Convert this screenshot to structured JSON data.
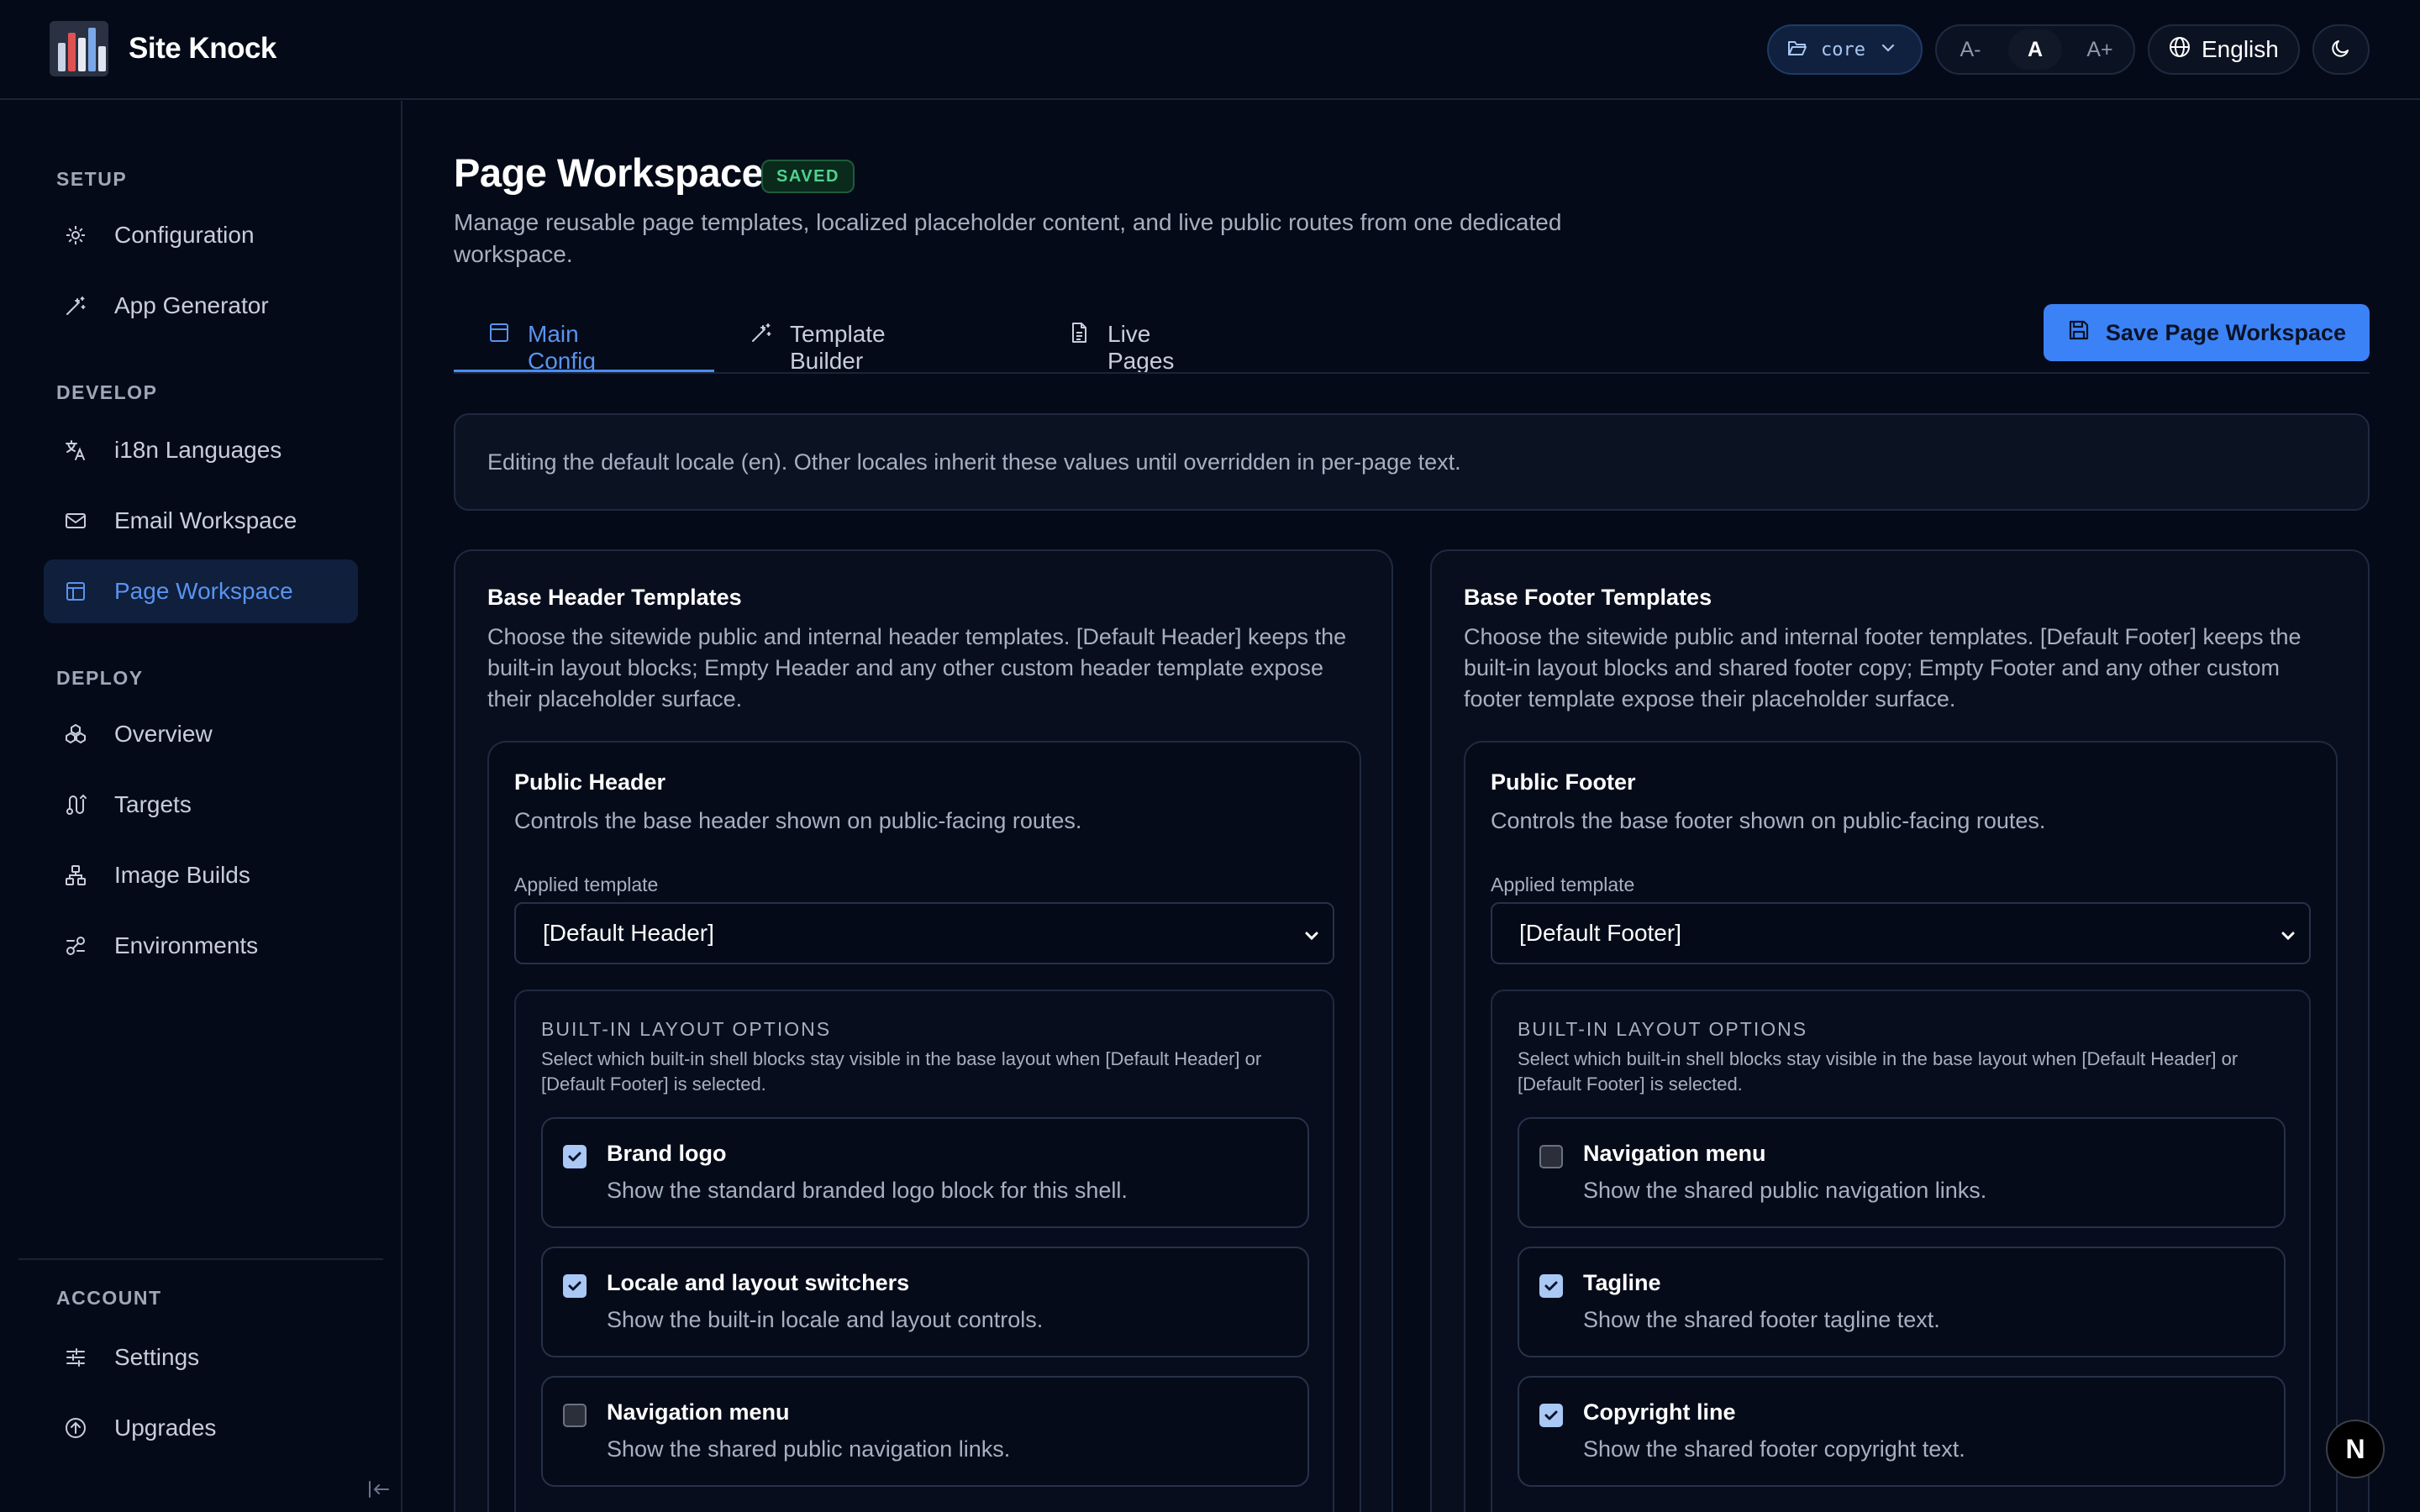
{
  "app": {
    "name": "Site Knock"
  },
  "topbar": {
    "project": "core",
    "size_small": "A-",
    "size_normal": "A",
    "size_large": "A+",
    "language": "English"
  },
  "sidebar": {
    "sections": [
      {
        "label": "SETUP",
        "items": [
          {
            "label": "Configuration"
          },
          {
            "label": "App Generator"
          }
        ]
      },
      {
        "label": "DEVELOP",
        "items": [
          {
            "label": "i18n Languages"
          },
          {
            "label": "Email Workspace"
          },
          {
            "label": "Page Workspace"
          }
        ]
      },
      {
        "label": "DEPLOY",
        "items": [
          {
            "label": "Overview"
          },
          {
            "label": "Targets"
          },
          {
            "label": "Image Builds"
          },
          {
            "label": "Environments"
          }
        ]
      },
      {
        "label": "ACCOUNT",
        "items": [
          {
            "label": "Settings"
          },
          {
            "label": "Upgrades"
          }
        ]
      }
    ]
  },
  "page": {
    "title": "Page Workspace",
    "badge": "SAVED",
    "subtitle": "Manage reusable page templates, localized placeholder content, and live public routes from one dedicated workspace.",
    "tabs": [
      {
        "label": "Main Config"
      },
      {
        "label": "Template Builder"
      },
      {
        "label": "Live Pages"
      }
    ],
    "save_label": "Save Page Workspace",
    "info": "Editing the default locale (en). Other locales inherit these values until overridden in per-page text."
  },
  "header_panel": {
    "title": "Base Header Templates",
    "desc": "Choose the sitewide public and internal header templates. [Default Header] keeps the built-in layout blocks; Empty Header and any other custom header template expose their placeholder surface.",
    "card_title": "Public Header",
    "card_desc": "Controls the base header shown on public-facing routes.",
    "field_label": "Applied template",
    "selected": "[Default Header]",
    "options_heading": "BUILT-IN LAYOUT OPTIONS",
    "options_desc": "Select which built-in shell blocks stay visible in the base layout when [Default Header] or [Default Footer] is selected.",
    "options": [
      {
        "title": "Brand logo",
        "desc": "Show the standard branded logo block for this shell.",
        "checked": true
      },
      {
        "title": "Locale and layout switchers",
        "desc": "Show the built-in locale and layout controls.",
        "checked": true
      },
      {
        "title": "Navigation menu",
        "desc": "Show the shared public navigation links.",
        "checked": false
      }
    ]
  },
  "footer_panel": {
    "title": "Base Footer Templates",
    "desc": "Choose the sitewide public and internal footer templates. [Default Footer] keeps the built-in layout blocks and shared footer copy; Empty Footer and any other custom footer template expose their placeholder surface.",
    "card_title": "Public Footer",
    "card_desc": "Controls the base footer shown on public-facing routes.",
    "field_label": "Applied template",
    "selected": "[Default Footer]",
    "options_heading": "BUILT-IN LAYOUT OPTIONS",
    "options_desc": "Select which built-in shell blocks stay visible in the base layout when [Default Header] or [Default Footer] is selected.",
    "options": [
      {
        "title": "Navigation menu",
        "desc": "Show the shared public navigation links.",
        "checked": false
      },
      {
        "title": "Tagline",
        "desc": "Show the shared footer tagline text.",
        "checked": true
      },
      {
        "title": "Copyright line",
        "desc": "Show the shared footer copyright text.",
        "checked": true
      }
    ]
  },
  "dev_badge": "N",
  "colors": {
    "accent": "#3b82f6",
    "background": "#050a18",
    "success": "#4fd28e"
  }
}
